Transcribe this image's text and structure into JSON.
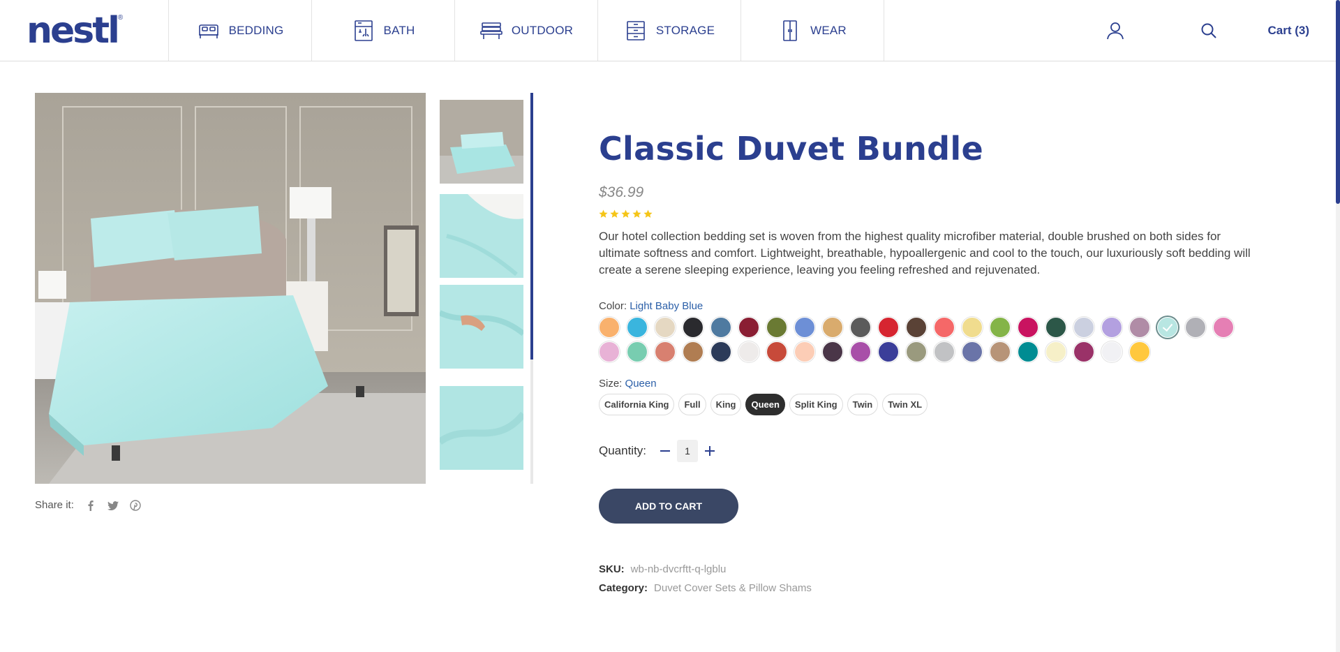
{
  "brand": {
    "logo_text": "nestl",
    "registered_mark": "®"
  },
  "nav": [
    {
      "label": "BEDDING",
      "icon": "bed-icon"
    },
    {
      "label": "BATH",
      "icon": "shower-icon"
    },
    {
      "label": "OUTDOOR",
      "icon": "bench-icon"
    },
    {
      "label": "STORAGE",
      "icon": "drawers-icon"
    },
    {
      "label": "WEAR",
      "icon": "wardrobe-icon"
    }
  ],
  "header": {
    "cart_label": "Cart (3)",
    "user_icon": "user-icon",
    "search_icon": "search-icon"
  },
  "share": {
    "label": "Share it:",
    "icons": [
      "facebook-icon",
      "twitter-icon",
      "pinterest-icon"
    ]
  },
  "product": {
    "title": "Classic Duvet Bundle",
    "price": "$36.99",
    "rating": 5,
    "description": "Our hotel collection bedding set is woven from the highest quality microfiber material, double brushed on both sides for ultimate softness and comfort. Lightweight, breathable, hypoallergenic and cool to the touch, our luxuriously soft bedding will create a serene sleeping experience, leaving you feeling refreshed and rejuvenated.",
    "color_label": "Color:",
    "color_value": "Light Baby Blue",
    "size_label": "Size:",
    "size_value": "Queen",
    "sizes": [
      "California King",
      "Full",
      "King",
      "Queen",
      "Split King",
      "Twin",
      "Twin XL"
    ],
    "selected_size": "Queen",
    "quantity_label": "Quantity:",
    "quantity": "1",
    "add_to_cart": "ADD TO CART",
    "sku_label": "SKU:",
    "sku": "wb-nb-dvcrftt-q-lgblu",
    "category_label": "Category:",
    "category": "Duvet Cover Sets & Pillow Shams"
  },
  "swatch_colors": [
    "#f9b16d",
    "#3ab5de",
    "#e5d8c2",
    "#2a2a2e",
    "#4f7aa0",
    "#8a1e33",
    "#6a7a33",
    "#6d8fd6",
    "#d9ab6d",
    "#5b5b5b",
    "#d62530",
    "#5a4236",
    "#f56868",
    "#f0dc8e",
    "#84b448",
    "#c91360",
    "#2c5748",
    "#cbd0e0",
    "#b3a0e0",
    "#b08ca6",
    "#b8e6e2",
    "#b0b0b6",
    "#e57fb4",
    "#e8b2d6",
    "#78cdb0",
    "#d88070",
    "#b07d52",
    "#2c3b59",
    "#eeebea",
    "#c74a3a",
    "#fccdb6",
    "#4a3648",
    "#a84fa8",
    "#3b3e99",
    "#9a9a7e",
    "#c1c2c4",
    "#6a74a8",
    "#b79478",
    "#008c92",
    "#f6f0c8",
    "#9a3268",
    "#f1f1f4",
    "#ffc83e"
  ],
  "selected_swatch_index": 20,
  "accent_color": "#2b3f8f"
}
